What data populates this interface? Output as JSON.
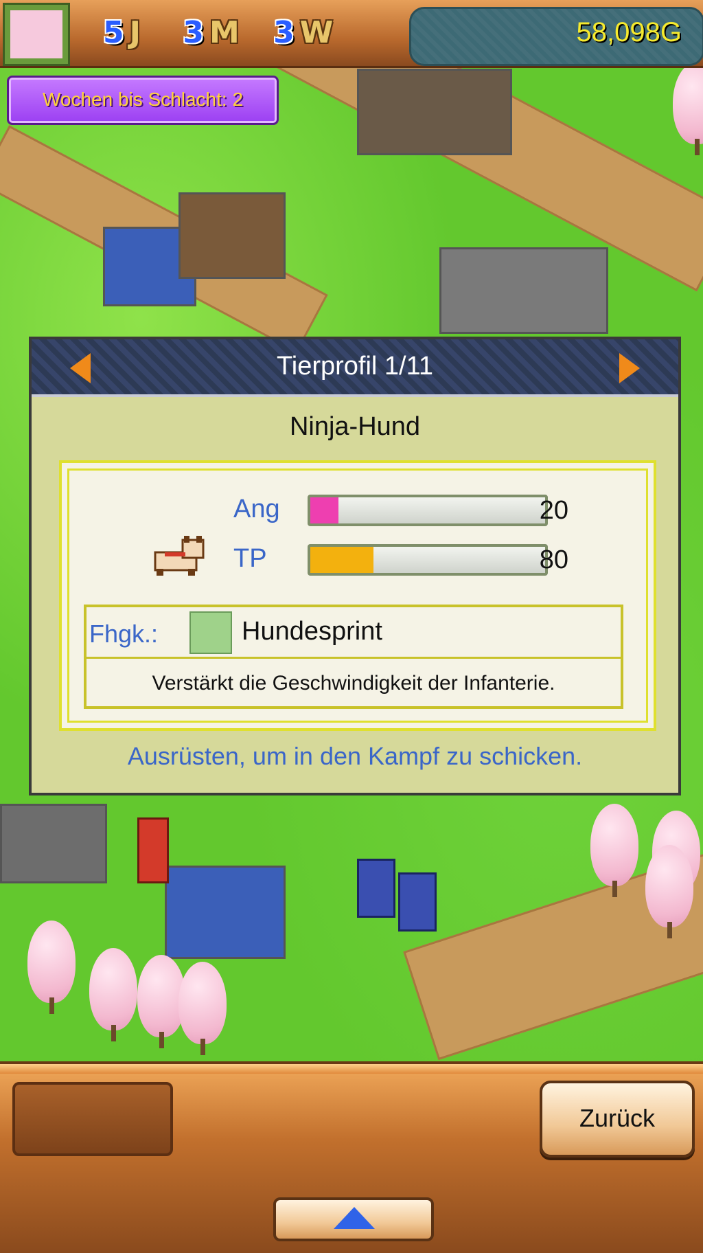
{
  "topbar": {
    "year_num": "5",
    "year_unit": "J",
    "month_num": "3",
    "month_unit": "M",
    "week_num": "3",
    "week_unit": "W",
    "gold": "58,098G"
  },
  "weeks_banner": "Wochen bis Schlacht: 2",
  "dialog": {
    "title": "Tierprofil 1/11",
    "animal_name": "Ninja-Hund",
    "stats": [
      {
        "label": "Ang",
        "value": "20",
        "fill": 0.12,
        "color": "#ee3fb0"
      },
      {
        "label": "TP",
        "value": "80",
        "fill": 0.27,
        "color": "#f3b10e"
      }
    ],
    "skill_label": "Fhgk.:",
    "skill_name": "Hundesprint",
    "skill_description": "Verstärkt die Geschwindigkeit der Infanterie.",
    "hint": "Ausrüsten, um in den Kampf zu schicken."
  },
  "bottom": {
    "back_label": "Zurück"
  }
}
